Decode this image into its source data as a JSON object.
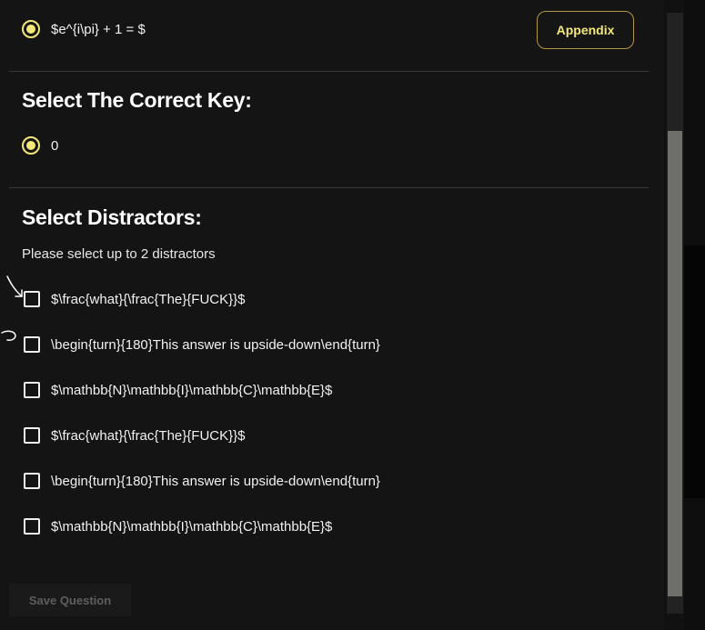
{
  "question": {
    "selected_option": "$e^{i\\pi} + 1 = $",
    "appendix_label": "Appendix"
  },
  "correct_key": {
    "heading": "Select The Correct Key:",
    "selected_option": "0"
  },
  "distractors": {
    "heading": "Select Distractors:",
    "helper": "Please select up to 2 distractors",
    "options": [
      "$\\frac{what}{\\frac{The}{FUCK}}$",
      "\\begin{turn}{180}This answer is upside-down\\end{turn}",
      "$\\mathbb{N}\\mathbb{I}\\mathbb{C}\\mathbb{E}$",
      "$\\frac{what}{\\frac{The}{FUCK}}$",
      "\\begin{turn}{180}This answer is upside-down\\end{turn}",
      "$\\mathbb{N}\\mathbb{I}\\mathbb{C}\\mathbb{E}$"
    ]
  },
  "footer": {
    "save_label": "Save Question"
  },
  "colors": {
    "accent": "#f4e77a",
    "background": "#141414"
  }
}
